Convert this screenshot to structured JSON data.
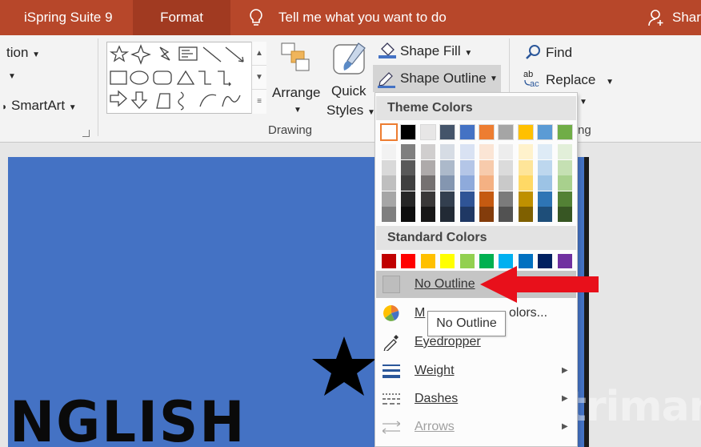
{
  "tabs": {
    "ispring": "iSpring Suite 9",
    "format": "Format",
    "tell_me": "Tell me what you want to do",
    "share": "Share"
  },
  "ribbon": {
    "insert_group": {
      "action_label": "tion",
      "smartart_label": "SmartArt"
    },
    "drawing_group": {
      "label": "Drawing",
      "arrange": "Arrange",
      "quick_styles_1": "Quick",
      "quick_styles_2": "Styles",
      "shape_fill": "Shape Fill",
      "shape_outline": "Shape Outline"
    },
    "editing_group": {
      "find": "Find",
      "replace": "Replace",
      "label_partial": "ng"
    }
  },
  "menu": {
    "theme_header": "Theme Colors",
    "standard_header": "Standard Colors",
    "theme_colors": [
      "#ffffff",
      "#000000",
      "#e7e6e6",
      "#44546a",
      "#4472c4",
      "#ed7d31",
      "#a5a5a5",
      "#ffc000",
      "#5b9bd5",
      "#70ad47"
    ],
    "theme_shades": [
      [
        "#f2f2f2",
        "#d9d9d9",
        "#bfbfbf",
        "#a6a6a6",
        "#7f7f7f"
      ],
      [
        "#7f7f7f",
        "#595959",
        "#3f3f3f",
        "#262626",
        "#0d0d0d"
      ],
      [
        "#d0cece",
        "#aeaaaa",
        "#757171",
        "#3a3838",
        "#171616"
      ],
      [
        "#d6dce4",
        "#acb9ca",
        "#8496b0",
        "#333f4f",
        "#222a35"
      ],
      [
        "#d9e2f3",
        "#b4c6e7",
        "#8eaadb",
        "#2f5496",
        "#1f3864"
      ],
      [
        "#fbe5d5",
        "#f7cbac",
        "#f4b183",
        "#c55a11",
        "#833c0b"
      ],
      [
        "#ededed",
        "#dbdbdb",
        "#c9c9c9",
        "#7b7b7b",
        "#525252"
      ],
      [
        "#fff2cc",
        "#fee599",
        "#ffd965",
        "#bf9000",
        "#7f6000"
      ],
      [
        "#deebf6",
        "#bdd7ee",
        "#9cc3e5",
        "#2e75b5",
        "#1e4e79"
      ],
      [
        "#e2efd9",
        "#c5e0b3",
        "#a8d08d",
        "#538135",
        "#375623"
      ]
    ],
    "standard_colors": [
      "#c00000",
      "#ff0000",
      "#ffc000",
      "#ffff00",
      "#92d050",
      "#00b050",
      "#00b0f0",
      "#0070c0",
      "#002060",
      "#7030a0"
    ],
    "items": {
      "no_outline": "No Outline",
      "more_colors_start": "M",
      "more_colors_end": "olors...",
      "eyedropper": "Eyedropper",
      "weight": "Weight",
      "dashes": "Dashes",
      "arrows": "Arrows"
    },
    "tooltip": "No Outline"
  },
  "slide": {
    "title_fragment": "NGLISH",
    "background_color": "#4472c4"
  },
  "watermark": "uantrimang"
}
